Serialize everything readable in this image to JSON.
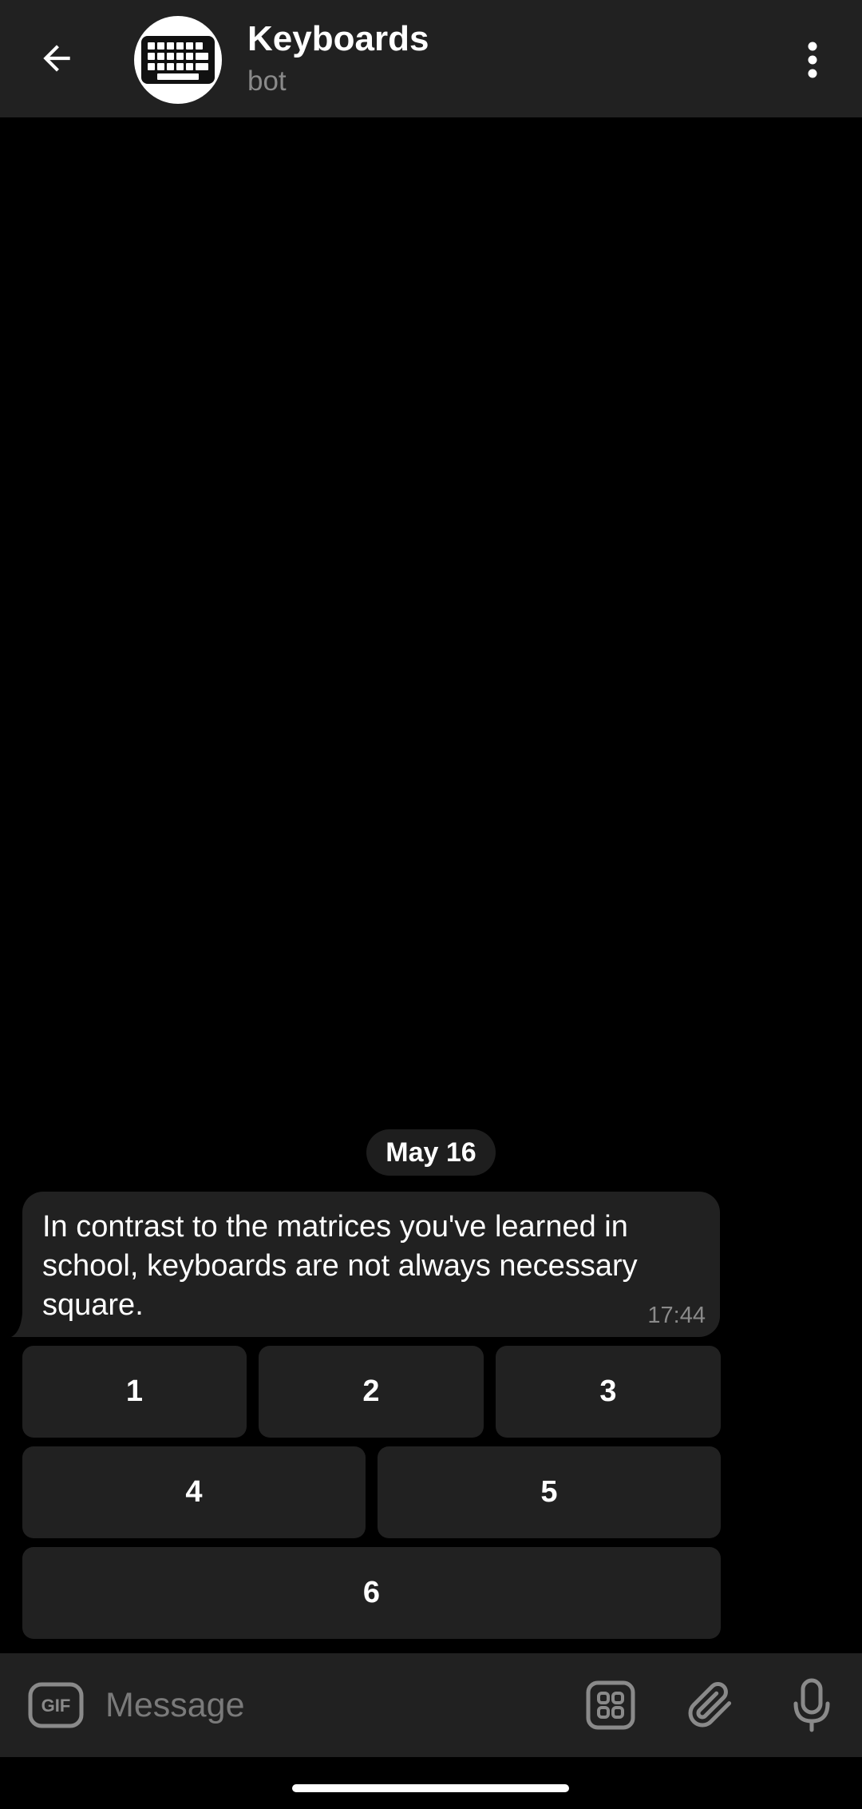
{
  "header": {
    "title": "Keyboards",
    "subtitle": "bot",
    "back_icon": "arrow-left-icon",
    "avatar_icon": "keyboard-icon",
    "menu_icon": "more-vertical-icon"
  },
  "chat": {
    "date_label": "May 16",
    "message": {
      "text": "In contrast to the matrices you've learned in school, keyboards are not always necessary square.",
      "time": "17:44"
    },
    "keyboard": {
      "rows": [
        [
          "1",
          "2",
          "3"
        ],
        [
          "4",
          "5"
        ],
        [
          "6"
        ]
      ]
    }
  },
  "input_bar": {
    "placeholder": "Message",
    "gif_icon": "gif-icon",
    "emoji_icon": "sticker-grid-icon",
    "attach_icon": "paperclip-icon",
    "mic_icon": "microphone-icon"
  },
  "colors": {
    "background": "#000000",
    "surface": "#212121",
    "text_primary": "#ffffff",
    "text_secondary": "#8a8a8a"
  }
}
